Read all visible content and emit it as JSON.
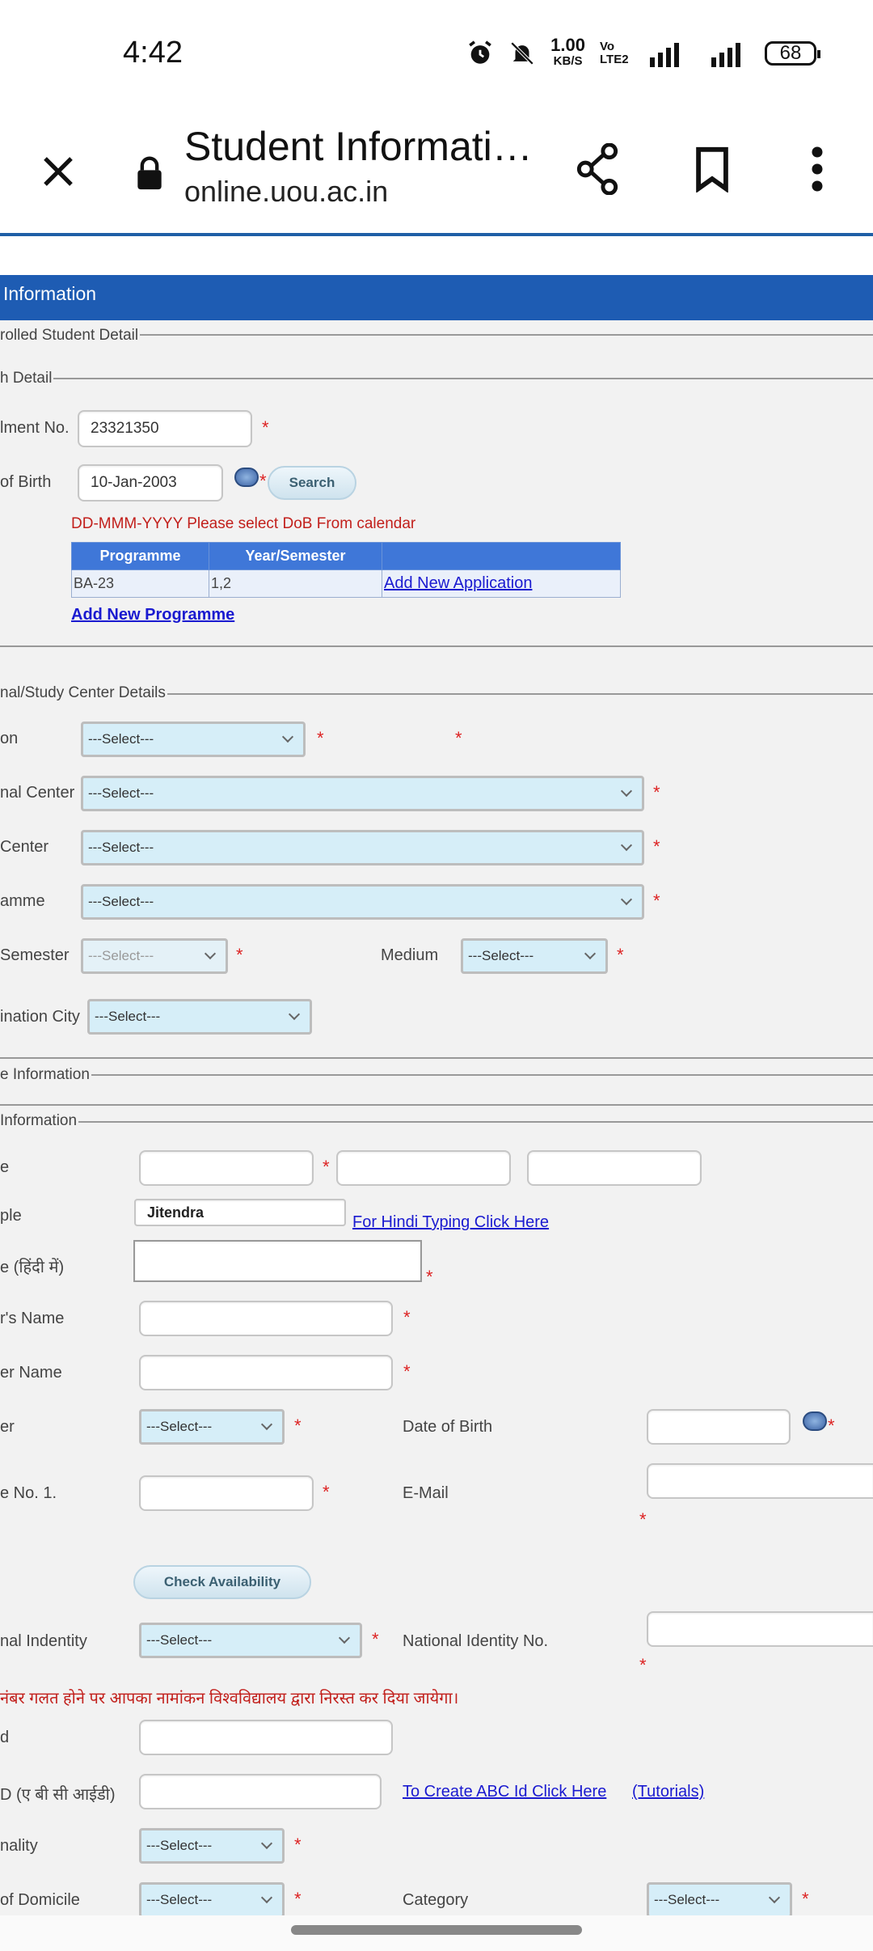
{
  "status_bar": {
    "time": "4:42",
    "net_speed_value": "1.00",
    "net_speed_unit": "KB/S",
    "volte": "Vo LTE2",
    "battery": "68",
    "icons": [
      "alarm-icon",
      "mute-bell-icon",
      "signal-icon",
      "battery-icon"
    ]
  },
  "browser": {
    "title": "Student Informati…",
    "url": "online.uou.ac.in"
  },
  "header": {
    "title": "Information"
  },
  "enrolled": {
    "legend": "rolled Student Detail",
    "search_legend": "h Detail",
    "enrolment_label": "lment No.",
    "enrolment_value": "23321350",
    "dob_label": "of Birth",
    "dob_value": "10-Jan-2003",
    "search_btn": "Search",
    "dob_hint": "DD-MMM-YYYY Please select DoB From calendar",
    "table": {
      "headers": [
        "Programme",
        "Year/Semester",
        ""
      ],
      "rows": [
        {
          "programme": "BA-23",
          "semester": "1,2",
          "action": "Add New Application"
        }
      ]
    },
    "add_programme": "Add New Programme"
  },
  "study_center": {
    "legend": "nal/Study Center Details",
    "region_label": "on",
    "regional_label": "nal Center",
    "study_label": " Center",
    "programme_label": "amme",
    "semester_label": "Semester",
    "medium_label": "Medium",
    "exam_city_label": "ination City",
    "select_placeholder": "---Select---"
  },
  "personal": {
    "outer_legend": "e Information",
    "legend": " Information",
    "name_label": "e",
    "name_sample_label": "ple",
    "name_sample_value": "Jitendra",
    "hindi_link": "For Hindi Typing Click Here",
    "hindi_name_label": "e (हिंदी में)",
    "father_label": "r's Name",
    "mother_label": "er Name",
    "gender_label": "er",
    "dob_label": "Date of Birth",
    "mobile_label": "e No. 1.",
    "email_label": "E-Mail",
    "check_btn": "Check Availability",
    "national_id_label": "nal Indentity",
    "national_id_no_label": "National Identity No.",
    "warning": "नंबर गलत होने पर आपका नामांकन विश्वविद्यालय द्वारा निरस्त कर दिया जायेगा।",
    "aadhaar_label": "d",
    "abc_label": "D (ए बी सी आईडी)",
    "abc_link": "To Create ABC Id Click Here",
    "tutorials_link": "(Tutorials)",
    "nationality_label": "nality",
    "domicile_label": "of Domicile",
    "category_label": "Category",
    "select_placeholder": "---Select---"
  },
  "colors": {
    "header": "#1e5cb3",
    "select_bg": "#d6eef8",
    "required": "#dd2222",
    "link": "#1a1ad0"
  }
}
